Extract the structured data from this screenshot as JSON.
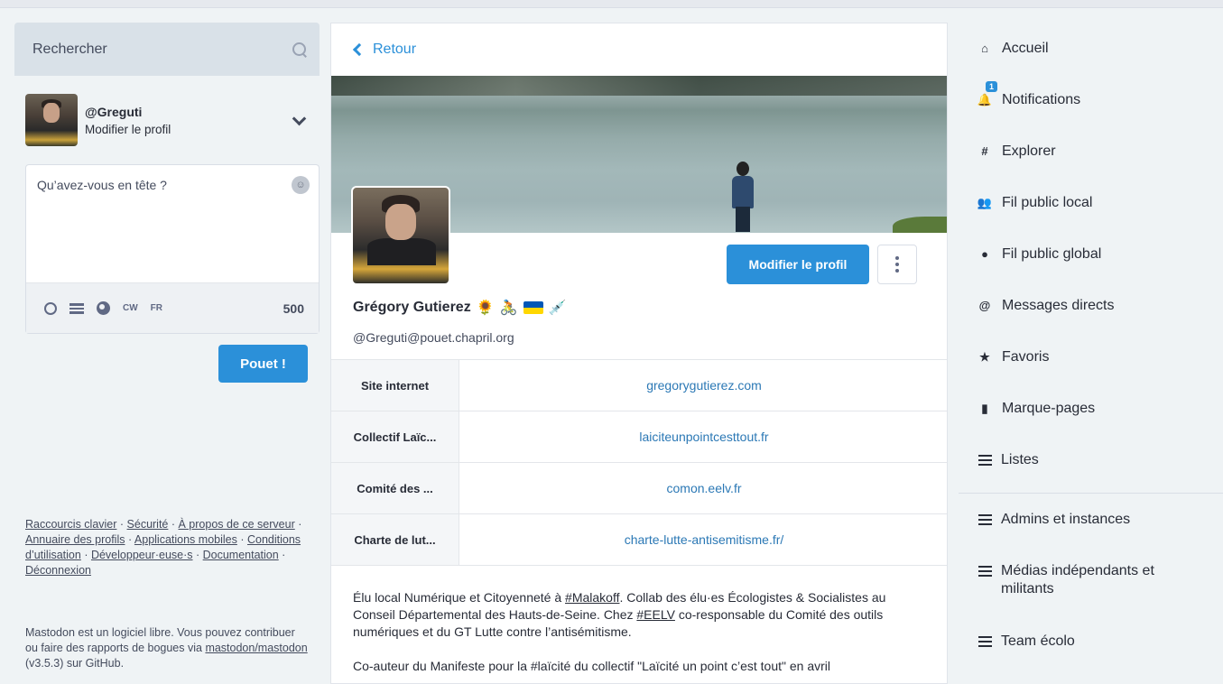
{
  "search": {
    "placeholder": "Rechercher"
  },
  "account": {
    "handle": "@Greguti",
    "edit_label": "Modifier le profil"
  },
  "composer": {
    "placeholder": "Qu’avez-vous en tête ?",
    "tools": {
      "cw": "CW",
      "lang": "FR"
    },
    "counter": "500",
    "submit_label": "Pouet !"
  },
  "footer": {
    "links": [
      "Raccourcis clavier",
      "Sécurité",
      "À propos de ce serveur",
      "Annuaire des profils",
      "Applications mobiles",
      "Conditions d’utilisation",
      "Développeur·euse·s",
      "Documentation",
      "Déconnexion"
    ],
    "about_1": "Mastodon est un logiciel libre. Vous pouvez contribuer ou faire des rapports de bogues via ",
    "about_link": "mastodon/mastodon",
    "about_2": " (v3.5.3) sur GitHub."
  },
  "profile": {
    "back_label": "Retour",
    "edit_button": "Modifier le profil",
    "display_name": "Grégory Gutierez",
    "emojis": [
      "🌻",
      "🚴"
    ],
    "emoji_syringe": "💉",
    "acct": "@Greguti@pouet.chapril.org",
    "fields": [
      {
        "name": "Site internet",
        "value": "gregorygutierez.com"
      },
      {
        "name": "Collectif Laïc...",
        "value": "laiciteunpointcesttout.fr"
      },
      {
        "name": "Comité des ...",
        "value": "comon.eelv.fr"
      },
      {
        "name": "Charte de lut...",
        "value": "charte-lutte-antisemitisme.fr/"
      }
    ],
    "bio": {
      "p1_a": "Élu local Numérique et Citoyenneté à ",
      "p1_tag1": "#Malakoff",
      "p1_b": ". Collab des élu·es Écologistes & Socialistes au Conseil Départemental des Hauts-de-Seine. Chez ",
      "p1_tag2": "#EELV",
      "p1_c": " co-responsable du Comité des outils numériques et du GT Lutte contre l’antisémitisme.",
      "p2": "Co-auteur du Manifeste pour la #laïcité du collectif \"Laïcité un point c’est tout\" en avril"
    }
  },
  "nav": {
    "notifications_badge": "1",
    "items": [
      "Accueil",
      "Notifications",
      "Explorer",
      "Fil public local",
      "Fil public global",
      "Messages directs",
      "Favoris",
      "Marque-pages",
      "Listes"
    ],
    "lists": [
      "Admins et instances",
      "Médias indépendants et militants",
      "Team écolo"
    ]
  },
  "colors": {
    "accent": "#2b90d9",
    "background": "#eff3f5"
  }
}
